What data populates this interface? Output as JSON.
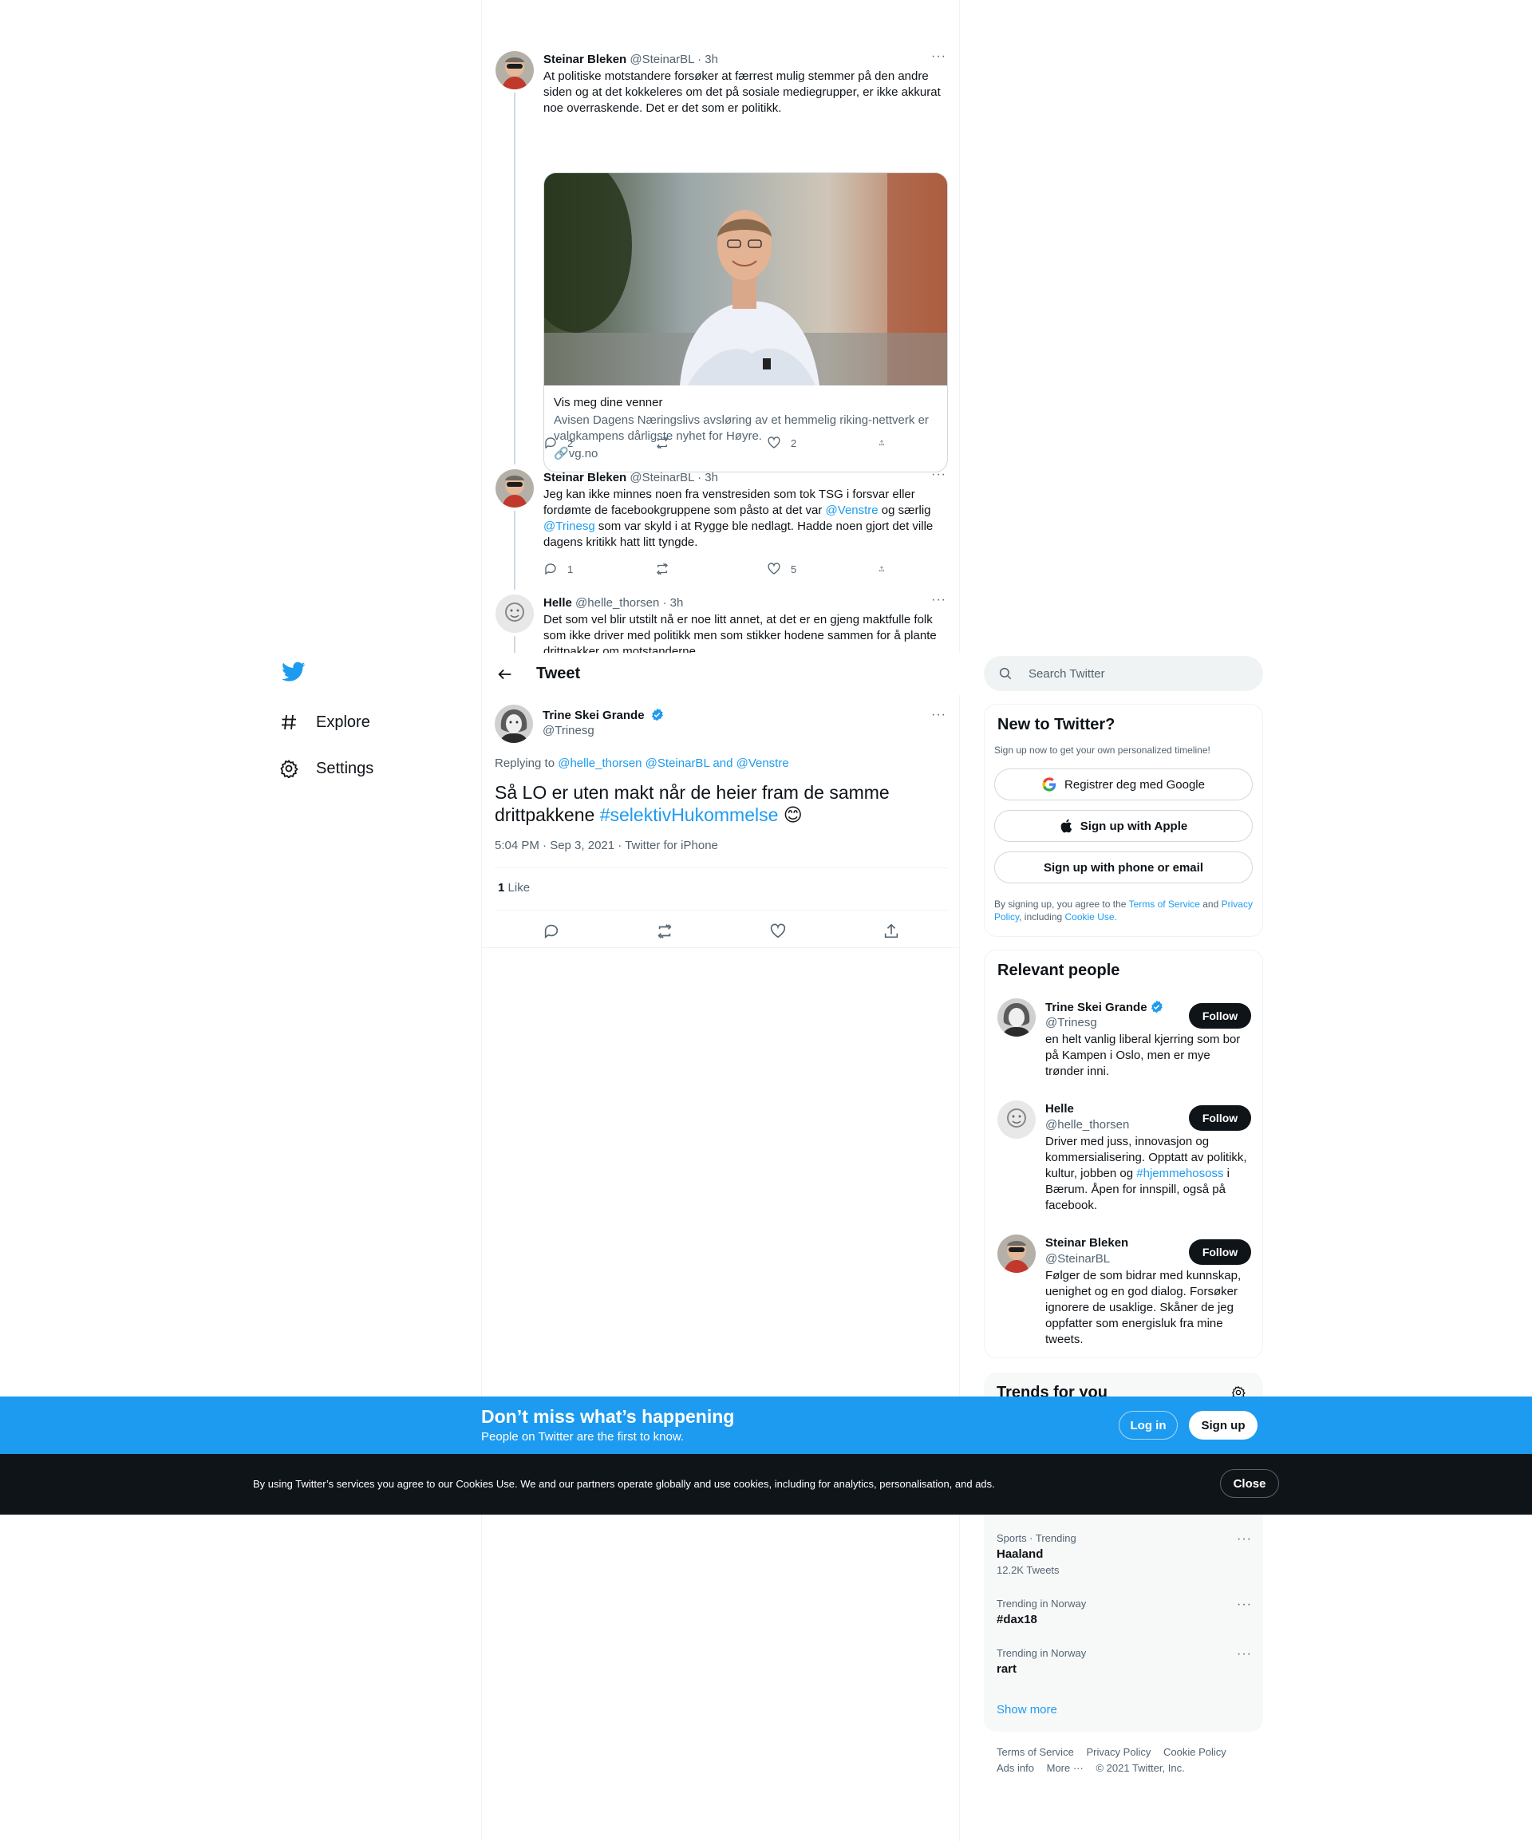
{
  "nav": {
    "items": [
      {
        "label": "Explore",
        "icon": "hashtag-icon"
      },
      {
        "label": "Settings",
        "icon": "gear-icon"
      }
    ]
  },
  "thread": [
    {
      "name": "Steinar Bleken",
      "handle": "@SteinarBL",
      "time": "3h",
      "text": "At politiske motstandere forsøker at færrest mulig stemmer på den andre siden og at det kokkeleres om det på sosiale mediegrupper, er ikke akkurat noe overraskende. Det er det som er politikk.",
      "card": {
        "title": "Vis meg dine venner",
        "description": "Avisen Dagens Næringslivs avsløring av et hemmelig riking-nettverk er valgkampens dårligste nyhet for Høyre.",
        "domain": "vg.no"
      },
      "replies": "2",
      "retweets": "",
      "likes": "2"
    },
    {
      "name": "Steinar Bleken",
      "handle": "@SteinarBL",
      "time": "3h",
      "text_parts": [
        "Jeg kan ikke minnes noen fra venstresiden som tok TSG i forsvar eller fordømte de facebookgruppene som påsto at det var ",
        "@Venstre",
        " og særlig ",
        "@Trinesg",
        " som var skyld i at Rygge ble nedlagt. Hadde noen gjort det ville dagens kritikk hatt litt tyngde."
      ],
      "replies": "1",
      "retweets": "",
      "likes": "5"
    },
    {
      "name": "Helle",
      "handle": "@helle_thorsen",
      "time": "3h",
      "text": "Det som vel blir utstilt nå er noe litt annet, at det er en gjeng maktfulle folk som ikke driver med politikk men som stikker hodene sammen for å plante drittpakker om motstanderne."
    }
  ],
  "header": {
    "title": "Tweet"
  },
  "main_tweet": {
    "name": "Trine Skei Grande",
    "handle": "@Trinesg",
    "replying_label": "Replying to",
    "replying_to": "@helle_thorsen @SteinarBL and @Venstre",
    "text": "Så LO er uten makt når de heier fram de samme drittpakkene ",
    "hashtag": "#selektivHukommelse",
    "emoji": "😊",
    "timestamp": "5:04 PM · Sep 3, 2021 · Twitter for iPhone",
    "likes_count": "1",
    "likes_label": "Like"
  },
  "search": {
    "placeholder": "Search Twitter"
  },
  "signup": {
    "title": "New to Twitter?",
    "subtitle": "Sign up now to get your own personalized timeline!",
    "google": "Registrer deg med Google",
    "apple": "Sign up with Apple",
    "phone": "Sign up with phone or email",
    "legal_1": "By signing up, you agree to the ",
    "tos": "Terms of Service",
    "legal_2": " and ",
    "privacy": "Privacy Policy",
    "legal_3": ", including ",
    "cookie": "Cookie Use."
  },
  "relevant": {
    "title": "Relevant people",
    "follow_label": "Follow",
    "people": [
      {
        "name": "Trine Skei Grande",
        "handle": "@Trinesg",
        "bio": "en helt vanlig liberal kjerring som bor på Kampen i Oslo, men er mye trønder inni."
      },
      {
        "name": "Helle",
        "handle": "@helle_thorsen",
        "bio_parts": [
          "Driver med juss, innovasjon og kommersialisering. Opptatt av politikk, kultur, jobben og ",
          "#hjemmehososs",
          " i Bærum. Åpen for innspill, også på facebook."
        ]
      },
      {
        "name": "Steinar Bleken",
        "handle": "@SteinarBL",
        "bio": "Følger de som bidrar med kunnskap, uenighet og en god dialog. Forsøker ignorere de usaklige. Skåner de jeg oppfatter som energisluk fra mine tweets."
      }
    ]
  },
  "trends": {
    "title": "Trends for you",
    "items": [
      {
        "context": "Sports · Trending",
        "name": "Haaland",
        "count": "12.2K Tweets"
      },
      {
        "context": "Trending in Norway",
        "name": "#dax18",
        "count": ""
      },
      {
        "context": "Trending in Norway",
        "name": "rart",
        "count": ""
      }
    ],
    "show_more": "Show more"
  },
  "footer": {
    "links": [
      "Terms of Service",
      "Privacy Policy",
      "Cookie Policy"
    ],
    "ads": "Ads info",
    "more": "More ···",
    "copyright": "© 2021 Twitter, Inc."
  },
  "promo": {
    "title": "Don’t miss what’s happening",
    "subtitle": "People on Twitter are the first to know.",
    "login": "Log in",
    "signup": "Sign up"
  },
  "cookie_bar": {
    "text": "By using Twitter’s services you agree to our Cookies Use. We and our partners operate globally and use cookies, including for analytics, personalisation, and ads.",
    "close": "Close"
  },
  "colors": {
    "accent": "#1d9bf0",
    "text": "#0f1419",
    "muted": "#536471",
    "dark": "#0f1419"
  }
}
